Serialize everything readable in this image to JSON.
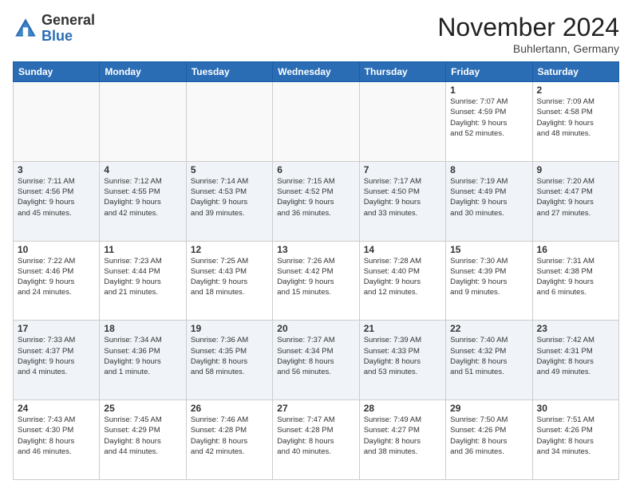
{
  "header": {
    "logo_general": "General",
    "logo_blue": "Blue",
    "month_title": "November 2024",
    "location": "Buhlertann, Germany"
  },
  "weekdays": [
    "Sunday",
    "Monday",
    "Tuesday",
    "Wednesday",
    "Thursday",
    "Friday",
    "Saturday"
  ],
  "weeks": [
    [
      {
        "day": "",
        "info": ""
      },
      {
        "day": "",
        "info": ""
      },
      {
        "day": "",
        "info": ""
      },
      {
        "day": "",
        "info": ""
      },
      {
        "day": "",
        "info": ""
      },
      {
        "day": "1",
        "info": "Sunrise: 7:07 AM\nSunset: 4:59 PM\nDaylight: 9 hours\nand 52 minutes."
      },
      {
        "day": "2",
        "info": "Sunrise: 7:09 AM\nSunset: 4:58 PM\nDaylight: 9 hours\nand 48 minutes."
      }
    ],
    [
      {
        "day": "3",
        "info": "Sunrise: 7:11 AM\nSunset: 4:56 PM\nDaylight: 9 hours\nand 45 minutes."
      },
      {
        "day": "4",
        "info": "Sunrise: 7:12 AM\nSunset: 4:55 PM\nDaylight: 9 hours\nand 42 minutes."
      },
      {
        "day": "5",
        "info": "Sunrise: 7:14 AM\nSunset: 4:53 PM\nDaylight: 9 hours\nand 39 minutes."
      },
      {
        "day": "6",
        "info": "Sunrise: 7:15 AM\nSunset: 4:52 PM\nDaylight: 9 hours\nand 36 minutes."
      },
      {
        "day": "7",
        "info": "Sunrise: 7:17 AM\nSunset: 4:50 PM\nDaylight: 9 hours\nand 33 minutes."
      },
      {
        "day": "8",
        "info": "Sunrise: 7:19 AM\nSunset: 4:49 PM\nDaylight: 9 hours\nand 30 minutes."
      },
      {
        "day": "9",
        "info": "Sunrise: 7:20 AM\nSunset: 4:47 PM\nDaylight: 9 hours\nand 27 minutes."
      }
    ],
    [
      {
        "day": "10",
        "info": "Sunrise: 7:22 AM\nSunset: 4:46 PM\nDaylight: 9 hours\nand 24 minutes."
      },
      {
        "day": "11",
        "info": "Sunrise: 7:23 AM\nSunset: 4:44 PM\nDaylight: 9 hours\nand 21 minutes."
      },
      {
        "day": "12",
        "info": "Sunrise: 7:25 AM\nSunset: 4:43 PM\nDaylight: 9 hours\nand 18 minutes."
      },
      {
        "day": "13",
        "info": "Sunrise: 7:26 AM\nSunset: 4:42 PM\nDaylight: 9 hours\nand 15 minutes."
      },
      {
        "day": "14",
        "info": "Sunrise: 7:28 AM\nSunset: 4:40 PM\nDaylight: 9 hours\nand 12 minutes."
      },
      {
        "day": "15",
        "info": "Sunrise: 7:30 AM\nSunset: 4:39 PM\nDaylight: 9 hours\nand 9 minutes."
      },
      {
        "day": "16",
        "info": "Sunrise: 7:31 AM\nSunset: 4:38 PM\nDaylight: 9 hours\nand 6 minutes."
      }
    ],
    [
      {
        "day": "17",
        "info": "Sunrise: 7:33 AM\nSunset: 4:37 PM\nDaylight: 9 hours\nand 4 minutes."
      },
      {
        "day": "18",
        "info": "Sunrise: 7:34 AM\nSunset: 4:36 PM\nDaylight: 9 hours\nand 1 minute."
      },
      {
        "day": "19",
        "info": "Sunrise: 7:36 AM\nSunset: 4:35 PM\nDaylight: 8 hours\nand 58 minutes."
      },
      {
        "day": "20",
        "info": "Sunrise: 7:37 AM\nSunset: 4:34 PM\nDaylight: 8 hours\nand 56 minutes."
      },
      {
        "day": "21",
        "info": "Sunrise: 7:39 AM\nSunset: 4:33 PM\nDaylight: 8 hours\nand 53 minutes."
      },
      {
        "day": "22",
        "info": "Sunrise: 7:40 AM\nSunset: 4:32 PM\nDaylight: 8 hours\nand 51 minutes."
      },
      {
        "day": "23",
        "info": "Sunrise: 7:42 AM\nSunset: 4:31 PM\nDaylight: 8 hours\nand 49 minutes."
      }
    ],
    [
      {
        "day": "24",
        "info": "Sunrise: 7:43 AM\nSunset: 4:30 PM\nDaylight: 8 hours\nand 46 minutes."
      },
      {
        "day": "25",
        "info": "Sunrise: 7:45 AM\nSunset: 4:29 PM\nDaylight: 8 hours\nand 44 minutes."
      },
      {
        "day": "26",
        "info": "Sunrise: 7:46 AM\nSunset: 4:28 PM\nDaylight: 8 hours\nand 42 minutes."
      },
      {
        "day": "27",
        "info": "Sunrise: 7:47 AM\nSunset: 4:28 PM\nDaylight: 8 hours\nand 40 minutes."
      },
      {
        "day": "28",
        "info": "Sunrise: 7:49 AM\nSunset: 4:27 PM\nDaylight: 8 hours\nand 38 minutes."
      },
      {
        "day": "29",
        "info": "Sunrise: 7:50 AM\nSunset: 4:26 PM\nDaylight: 8 hours\nand 36 minutes."
      },
      {
        "day": "30",
        "info": "Sunrise: 7:51 AM\nSunset: 4:26 PM\nDaylight: 8 hours\nand 34 minutes."
      }
    ]
  ]
}
